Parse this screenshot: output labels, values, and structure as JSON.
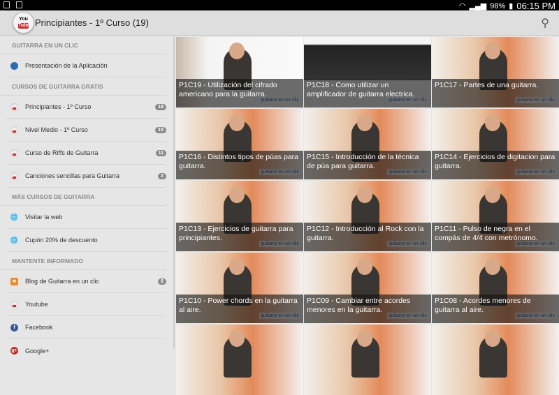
{
  "status": {
    "battery": "98%",
    "time": "06:15 PM"
  },
  "header": {
    "title": "Principiantes - 1º Curso (19)",
    "logo_text": "YouTube"
  },
  "sidebar": {
    "sections": [
      {
        "title": "GUITARRA EN UN CLIC",
        "items": [
          {
            "label": "Presentación de la Aplicación",
            "icon": "app-icon"
          }
        ]
      },
      {
        "title": "CURSOS DE GUITARRA GRATIS",
        "items": [
          {
            "label": "Principiantes - 1º Curso",
            "icon": "youtube-icon",
            "badge": "19"
          },
          {
            "label": "Nivel Medio - 1º Curso",
            "icon": "youtube-icon",
            "badge": "15"
          },
          {
            "label": "Curso de Riffs de Guitarra",
            "icon": "youtube-icon",
            "badge": "11"
          },
          {
            "label": "Canciones sencillas para Guitarra",
            "icon": "youtube-icon",
            "badge": "2"
          }
        ]
      },
      {
        "title": "MÁS CURSOS DE GUITARRA",
        "items": [
          {
            "label": "Visitar la web",
            "icon": "globe-icon"
          },
          {
            "label": "Cupón 20% de descuento",
            "icon": "globe-icon"
          }
        ]
      },
      {
        "title": "MANTENTE INFORMADO",
        "items": [
          {
            "label": "Blog de Guitarra en un clic",
            "icon": "rss-icon",
            "badge": "6"
          },
          {
            "label": "Youtube",
            "icon": "youtube-icon"
          },
          {
            "label": "Facebook",
            "icon": "facebook-icon"
          },
          {
            "label": "Google+",
            "icon": "google-plus-icon"
          }
        ]
      }
    ]
  },
  "watermark": "guitarra en un clic",
  "videos": [
    {
      "title": "P1C19 - Utilización del cifrado americano para la guitarra."
    },
    {
      "title": "P1C18 - Como utilizar un amplificador de guitarra electrica."
    },
    {
      "title": "P1C17 - Partes de una guitarra."
    },
    {
      "title": "P1C16 - Distintos tipos de púas para guitarra."
    },
    {
      "title": "P1C15 - Introducción de la técnica de púa para guitarra."
    },
    {
      "title": "P1C14 - Ejercicios de digitacion para guitarra."
    },
    {
      "title": "P1C13 - Ejercicios de guitarra para principiantes."
    },
    {
      "title": "P1C12 - Introducción al Rock con la guitarra."
    },
    {
      "title": "P1C11 - Pulso de negra en el compás de 4/4 con metrónomo."
    },
    {
      "title": "P1C10 - Power chords en la guitarra al aire."
    },
    {
      "title": "P1C09 - Cambiar entre acordes menores en la guitarra."
    },
    {
      "title": "P1C08 - Acordes menores de guitarra al aire."
    }
  ]
}
